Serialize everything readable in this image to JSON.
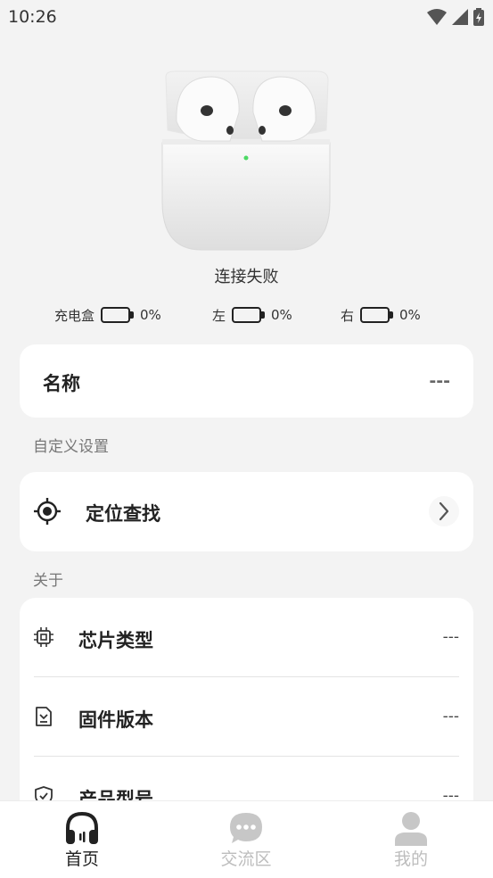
{
  "status_bar": {
    "time": "10:26"
  },
  "device": {
    "connection_status": "连接失败",
    "battery": [
      {
        "label": "充电盒",
        "percent": "0%",
        "level": 0
      },
      {
        "label": "左",
        "percent": "0%",
        "level": 0
      },
      {
        "label": "右",
        "percent": "0%",
        "level": 0
      }
    ]
  },
  "name_card": {
    "label": "名称",
    "value": "---"
  },
  "custom_section": {
    "title": "自定义设置",
    "locate_label": "定位查找"
  },
  "about_section": {
    "title": "关于",
    "rows": [
      {
        "label": "芯片类型",
        "value": "---",
        "icon": "chip-icon"
      },
      {
        "label": "固件版本",
        "value": "---",
        "icon": "firmware-icon"
      },
      {
        "label": "产品型号",
        "value": "---",
        "icon": "shield-check-icon"
      }
    ]
  },
  "tab_bar": {
    "tabs": [
      {
        "label": "首页",
        "icon": "headphones-icon",
        "active": true
      },
      {
        "label": "交流区",
        "icon": "chat-bubble-icon",
        "active": false
      },
      {
        "label": "我的",
        "icon": "person-icon",
        "active": false
      }
    ],
    "active_color": "#222222",
    "inactive_color": "#bdbdbd"
  }
}
